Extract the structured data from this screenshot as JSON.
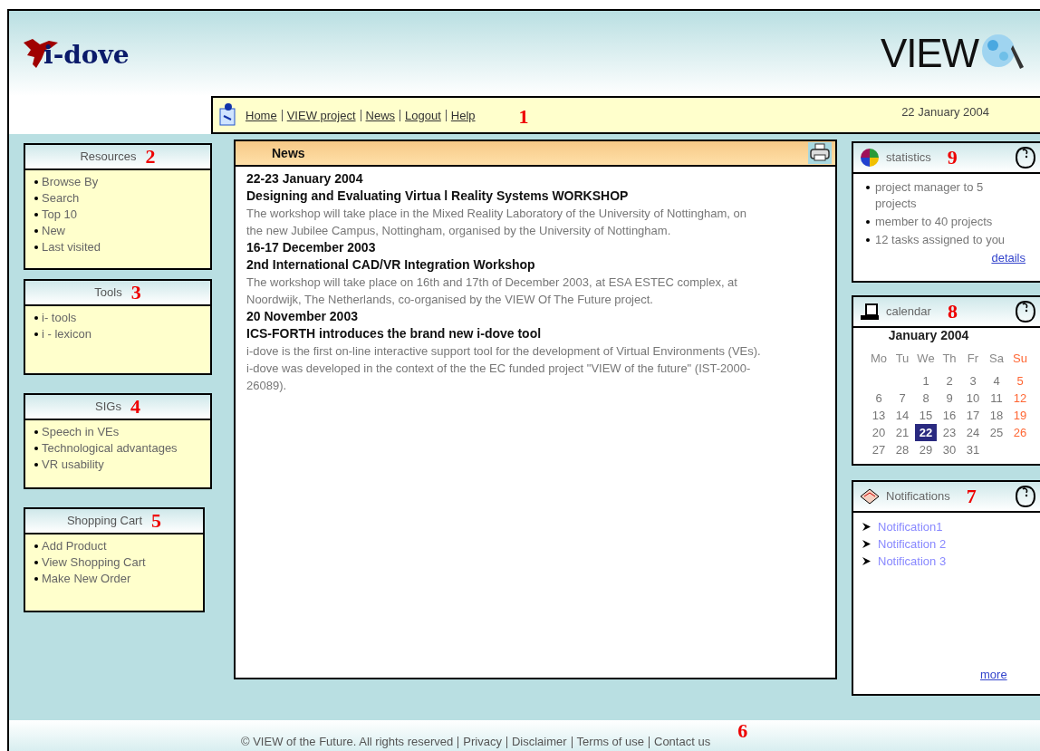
{
  "header": {
    "logo_text": "i-dove",
    "partner_logo_text": "VIEW"
  },
  "nav": {
    "links": [
      "Home",
      "VIEW project",
      "News",
      "Logout",
      "Help"
    ],
    "date": "22 January 2004",
    "marker": "1"
  },
  "left_boxes": [
    {
      "title": "Resources",
      "marker": "2",
      "items": [
        "Browse By",
        "Search",
        "Top 10",
        "New",
        "Last visited"
      ]
    },
    {
      "title": "Tools",
      "marker": "3",
      "items": [
        "i- tools",
        "i - lexicon"
      ]
    },
    {
      "title": "SIGs",
      "marker": "4",
      "items": [
        "Speech in VEs",
        "Technological advantages",
        "VR usability"
      ]
    },
    {
      "title": "Shopping Cart",
      "marker": "5",
      "items": [
        "Add Product",
        "View Shopping Cart",
        "Make New Order"
      ]
    }
  ],
  "news": {
    "title": "News",
    "entries": [
      {
        "date": "22-23 January 2004",
        "headline": "Designing and Evaluating Virtua l Reality Systems WORKSHOP",
        "body": "The workshop will take place in the Mixed Reality Laboratory of the University of Nottingham, on the new Jubilee Campus, Nottingham, organised by the University of Nottingham."
      },
      {
        "date": "16-17 December 2003",
        "headline": "2nd International CAD/VR Integration Workshop",
        "body": "The workshop will take place on 16th and 17th of December 2003, at ESA ESTEC complex, at Noordwijk, The Netherlands, co-organised by the VIEW Of The Future project."
      },
      {
        "date": "20 November 2003",
        "headline": "ICS-FORTH introduces the brand new i-dove tool",
        "body": "i-dove is the first on-line interactive support tool for the development of Virtual Environments (VEs). i-dove was developed in the context of the the EC funded project \"VIEW of the future\" (IST-2000-26089)."
      }
    ]
  },
  "statistics": {
    "title": "statistics",
    "marker": "9",
    "items": [
      "project manager to 5 projects",
      "member to 40 projects",
      "12 tasks assigned to you"
    ],
    "link": "details"
  },
  "calendar": {
    "title": "calendar",
    "marker": "8",
    "month": "January 2004",
    "weekdays": [
      "Mo",
      "Tu",
      "We",
      "Th",
      "Fr",
      "Sa",
      "Su"
    ],
    "weeks": [
      [
        {
          "day": "1",
          "selected": false
        },
        {
          "day": "2",
          "selected": false
        },
        {
          "day": "3",
          "selected": false
        },
        {
          "day": "4",
          "selected": false
        },
        {
          "day": "5",
          "selected": false
        }
      ],
      [
        {
          "day": "6",
          "selected": false
        },
        {
          "day": "7",
          "selected": false
        },
        {
          "day": "8",
          "selected": false
        },
        {
          "day": "9",
          "selected": false
        },
        {
          "day": "10",
          "selected": false
        },
        {
          "day": "11",
          "selected": false
        },
        {
          "day": "12",
          "selected": false
        }
      ],
      [
        {
          "day": "13",
          "selected": false
        },
        {
          "day": "14",
          "selected": false
        },
        {
          "day": "15",
          "selected": false
        },
        {
          "day": "16",
          "selected": false
        },
        {
          "day": "17",
          "selected": false
        },
        {
          "day": "18",
          "selected": false
        },
        {
          "day": "19",
          "selected": false
        }
      ],
      [
        {
          "day": "20",
          "selected": false
        },
        {
          "day": "21",
          "selected": false
        },
        {
          "day": "22",
          "selected": true
        },
        {
          "day": "23",
          "selected": false
        },
        {
          "day": "24",
          "selected": false
        },
        {
          "day": "25",
          "selected": false
        },
        {
          "day": "26",
          "selected": false
        }
      ],
      [
        {
          "day": "27",
          "selected": false
        },
        {
          "day": "28",
          "selected": false
        },
        {
          "day": "29",
          "selected": false
        },
        {
          "day": "30",
          "selected": false
        },
        {
          "day": "31",
          "selected": false
        }
      ]
    ]
  },
  "notifications": {
    "title": "Notifications",
    "marker": "7",
    "items": [
      "Notification1",
      "Notification 2",
      "Notification 3"
    ],
    "link": "more"
  },
  "footer": {
    "copyright": "© VIEW of the Future. All rights reserved",
    "links": [
      "Privacy",
      "Disclaimer",
      "Terms of use",
      "Contact us"
    ],
    "marker": "6"
  }
}
